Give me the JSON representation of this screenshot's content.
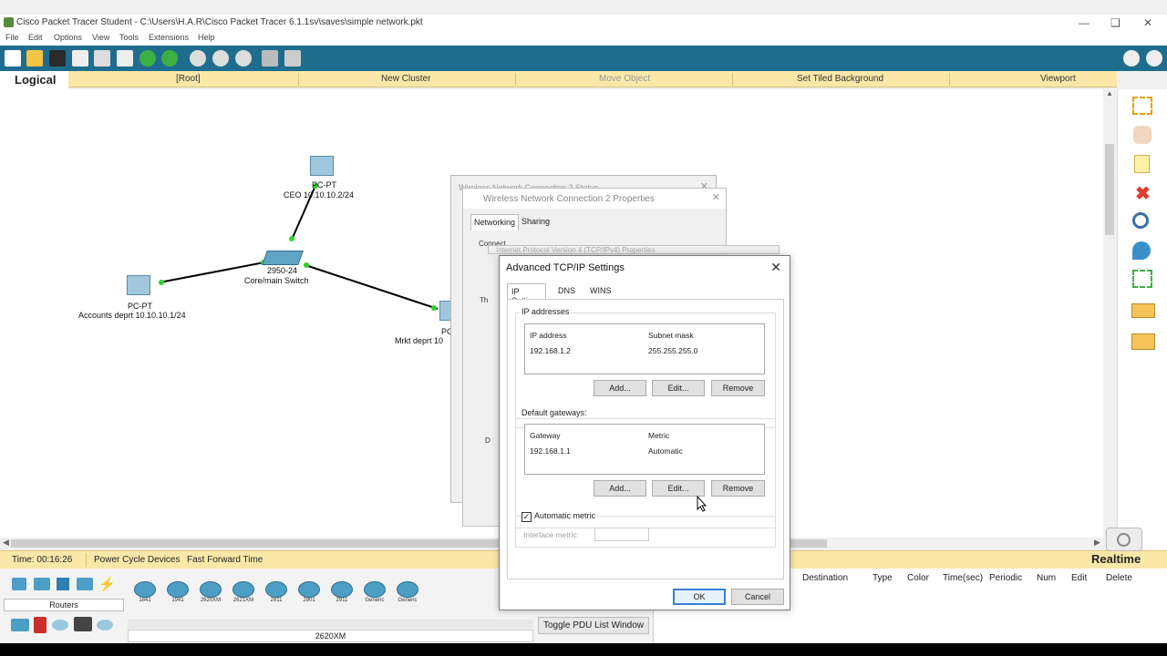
{
  "window": {
    "title": "Cisco Packet Tracer Student - C:\\Users\\H.A.R\\Cisco Packet Tracer 6.1.1sv\\saves\\simple network.pkt"
  },
  "menu": [
    "File",
    "Edit",
    "Options",
    "View",
    "Tools",
    "Extensions",
    "Help"
  ],
  "workspace_bar": {
    "logical": "Logical",
    "root": "[Root]",
    "new_cluster": "New Cluster",
    "move_object": "Move Object",
    "set_tiled_background": "Set Tiled Background",
    "viewport": "Viewport"
  },
  "topology": {
    "ceo_type": "PC-PT",
    "ceo_label": "CEO 10.10.10.2/24",
    "switch_model": "2950-24",
    "switch_label": "Core/main  Switch",
    "accounts_type": "PC-PT",
    "accounts_label": "Accounts deprt 10.10.10.1/24",
    "mrkt_type": "PC",
    "mrkt_label": "Mrkt deprt 10"
  },
  "status": {
    "time": "Time: 00:16:26",
    "power_cycle": "Power Cycle Devices",
    "fast_forward": "Fast Forward Time",
    "mode": "Realtime"
  },
  "device_panel": {
    "category": "Routers",
    "models": [
      "1841",
      "1941",
      "2620XM",
      "2621XM",
      "2811",
      "2901",
      "2911",
      "Generic",
      "Generic"
    ],
    "selected_model": "2620XM",
    "toggle_pdu": "Toggle PDU List Window"
  },
  "pdu_table": {
    "columns": [
      "Destination",
      "Type",
      "Color",
      "Time(sec)",
      "Periodic",
      "Num",
      "Edit",
      "Delete"
    ]
  },
  "bg_dialogs": {
    "status_title": "Wireless Network Connection 2 Status",
    "properties_title": "Wireless Network Connection 2 Properties",
    "tab_networking": "Networking",
    "tab_sharing": "Sharing",
    "connect_partial": "Connect",
    "ipv4_title": "Internet Protocol Version 4 (TCP/IPv4) Properties",
    "this_partial": "Th",
    "d_partial": "D"
  },
  "advanced_dialog": {
    "title": "Advanced TCP/IP Settings",
    "tabs": [
      "IP Settings",
      "DNS",
      "WINS"
    ],
    "ip_section": "IP addresses",
    "ip_header": "IP address",
    "subnet_header": "Subnet mask",
    "ip_value": "192.168.1.2",
    "subnet_value": "255.255.255.0",
    "add": "Add...",
    "edit": "Edit...",
    "remove": "Remove",
    "gw_section": "Default gateways:",
    "gw_header": "Gateway",
    "metric_header": "Metric",
    "gw_value": "192.168.1.1",
    "metric_value": "Automatic",
    "auto_metric": "Automatic metric",
    "iface_metric": "Interface metric:",
    "ok": "OK",
    "cancel": "Cancel"
  }
}
